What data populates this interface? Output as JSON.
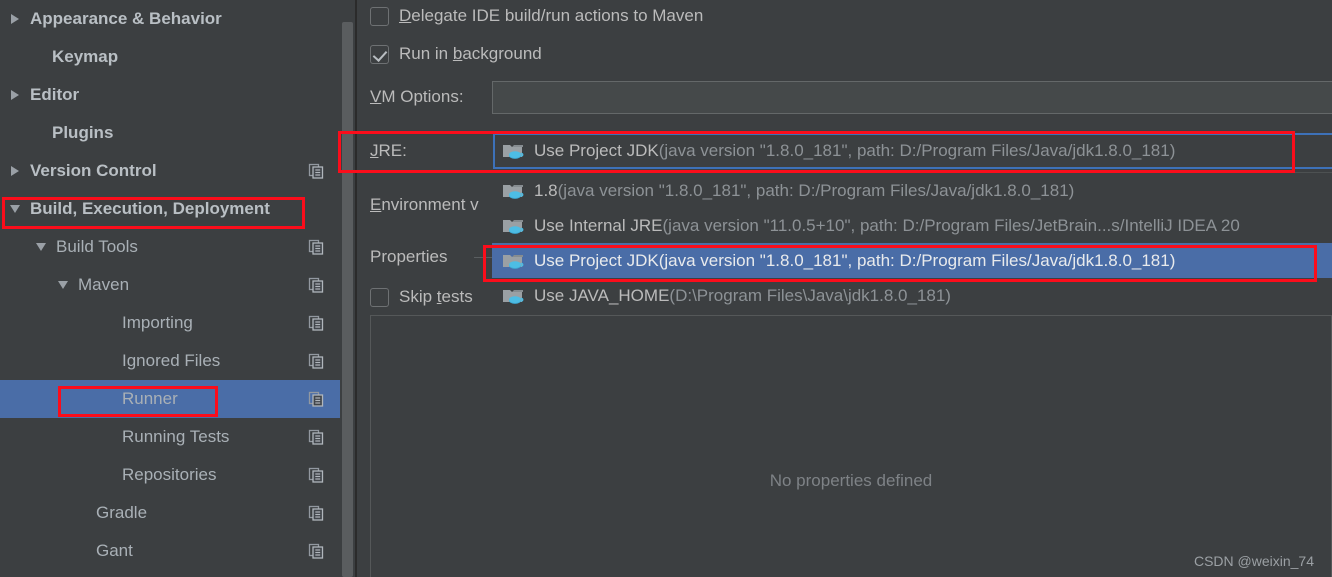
{
  "app": {
    "theme": "darcula"
  },
  "sidebar": {
    "items": [
      {
        "label": "Appearance & Behavior",
        "twisty": "right",
        "indent": 8,
        "bold": true,
        "copy": false,
        "selected": false
      },
      {
        "label": "Keymap",
        "twisty": "none",
        "indent": 30,
        "bold": true,
        "copy": false,
        "selected": false
      },
      {
        "label": "Editor",
        "twisty": "right",
        "indent": 8,
        "bold": true,
        "copy": false,
        "selected": false
      },
      {
        "label": "Plugins",
        "twisty": "none",
        "indent": 30,
        "bold": true,
        "copy": false,
        "selected": false
      },
      {
        "label": "Version Control",
        "twisty": "right",
        "indent": 8,
        "bold": true,
        "copy": true,
        "selected": false
      },
      {
        "label": "Build, Execution, Deployment",
        "twisty": "down",
        "indent": 8,
        "bold": true,
        "copy": false,
        "selected": false
      },
      {
        "label": "Build Tools",
        "twisty": "down",
        "indent": 34,
        "bold": false,
        "copy": true,
        "selected": false
      },
      {
        "label": "Maven",
        "twisty": "down",
        "indent": 56,
        "bold": false,
        "copy": true,
        "selected": false
      },
      {
        "label": "Importing",
        "twisty": "none",
        "indent": 100,
        "bold": false,
        "copy": true,
        "selected": false
      },
      {
        "label": "Ignored Files",
        "twisty": "none",
        "indent": 100,
        "bold": false,
        "copy": true,
        "selected": false
      },
      {
        "label": "Runner",
        "twisty": "none",
        "indent": 100,
        "bold": false,
        "copy": true,
        "selected": true
      },
      {
        "label": "Running Tests",
        "twisty": "none",
        "indent": 100,
        "bold": false,
        "copy": true,
        "selected": false
      },
      {
        "label": "Repositories",
        "twisty": "none",
        "indent": 100,
        "bold": false,
        "copy": true,
        "selected": false
      },
      {
        "label": "Gradle",
        "twisty": "none",
        "indent": 74,
        "bold": false,
        "copy": true,
        "selected": false
      },
      {
        "label": "Gant",
        "twisty": "none",
        "indent": 74,
        "bold": false,
        "copy": true,
        "selected": false
      }
    ]
  },
  "main": {
    "delegate_checkbox": {
      "label_pre": "",
      "label_mnemonic": "D",
      "label_post": "elegate IDE build/run actions to Maven",
      "checked": false
    },
    "background_checkbox": {
      "label_pre": "Run in ",
      "label_mnemonic": "b",
      "label_post": "ackground",
      "checked": true
    },
    "vm_options": {
      "label_mnemonic": "V",
      "label_post": "M Options:",
      "value": "",
      "placeholder": ""
    },
    "jre": {
      "label_mnemonic": "J",
      "label_post": "RE:",
      "selected_main": "Use Project JDK ",
      "selected_detail": "(java version \"1.8.0_181\", path: D:/Program Files/Java/jdk1.8.0_181)"
    },
    "env_label": {
      "label_mnemonic": "E",
      "label_post": "nvironment v"
    },
    "properties_label": "Properties",
    "skip_tests_checkbox": {
      "label_pre": "Skip ",
      "label_mnemonic": "t",
      "label_post": "ests",
      "checked": false
    },
    "properties_empty_text": "No properties defined",
    "watermark": "CSDN @weixin_74"
  },
  "jre_dropdown": {
    "items": [
      {
        "main": "1.8 ",
        "detail": "(java version \"1.8.0_181\", path: D:/Program Files/Java/jdk1.8.0_181)",
        "selected": false
      },
      {
        "main": "Use Internal JRE ",
        "detail": "(java version \"11.0.5+10\", path: D:/Program Files/JetBrain...s/IntelliJ IDEA 20",
        "selected": false
      },
      {
        "main": "Use Project JDK ",
        "detail": "(java version \"1.8.0_181\", path: D:/Program Files/Java/jdk1.8.0_181)",
        "selected": true
      },
      {
        "main": "Use JAVA_HOME ",
        "detail": "(D:\\Program Files\\Java\\jdk1.8.0_181)",
        "selected": false
      }
    ]
  },
  "annotations": {
    "color": "#fb0d1b",
    "boxes": [
      {
        "name": "build-execution-deployment-highlight"
      },
      {
        "name": "runner-highlight"
      },
      {
        "name": "jre-row-highlight"
      },
      {
        "name": "use-project-jdk-option-highlight"
      }
    ]
  }
}
